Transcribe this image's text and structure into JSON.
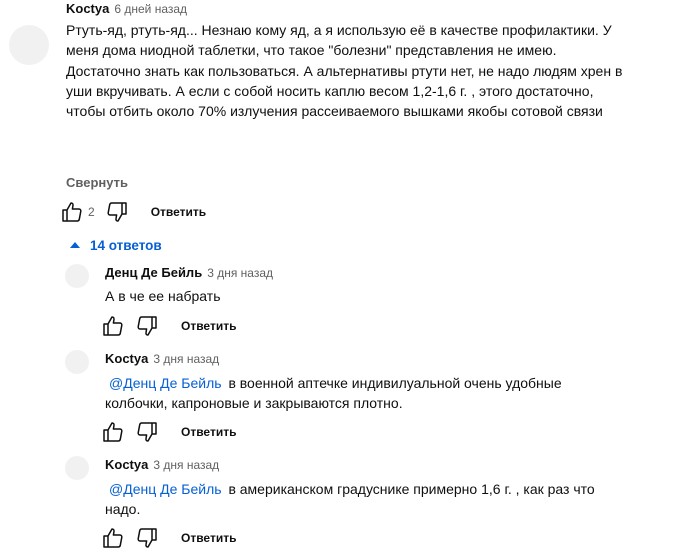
{
  "comment": {
    "author": "Koctya",
    "time": "6 дней назад",
    "text": "Ртуть-яд, ртуть-яд... Незнаю кому яд, а я использую её в качестве профилактики. У меня дома ниодной таблетки, что такое \"болезни\" представления не имею. Достаточно знать как пользоваться. А альтернативы ртути нет, не надо людям хрен в уши вкручивать. А если с собой носить каплю весом 1,2-1,6 г. , этого достаточно, чтобы отбить около 70% излучения рассеиваемого вышками якобы сотовой связи",
    "collapse_label": "Свернуть",
    "like_count": "2",
    "reply_label": "Ответить"
  },
  "replies_toggle": {
    "label": "14 ответов",
    "accent": "#065fd4"
  },
  "replies": [
    {
      "author": "Денц Де Бейль",
      "time": "3 дня назад",
      "mention": "",
      "text": "А в че ее набрать",
      "reply_label": "Ответить"
    },
    {
      "author": "Koctya",
      "time": "3 дня назад",
      "mention": "@Денц Де Бейль",
      "text": "в военной аптечке индивилуальной очень удобные колбочки, капроновые и закрываются плотно.",
      "reply_label": "Ответить"
    },
    {
      "author": "Koctya",
      "time": "3 дня назад",
      "mention": "@Денц Де Бейль",
      "text": "в американском градуснике примерно 1,6 г. , как раз что надо.",
      "reply_label": "Ответить"
    }
  ],
  "icons": {
    "like": "thumb-up-icon",
    "dislike": "thumb-down-icon",
    "expand": "caret-up-icon"
  },
  "colors": {
    "link": "#065fd4",
    "muted": "#606060",
    "avatar": "#f1f1f1"
  }
}
